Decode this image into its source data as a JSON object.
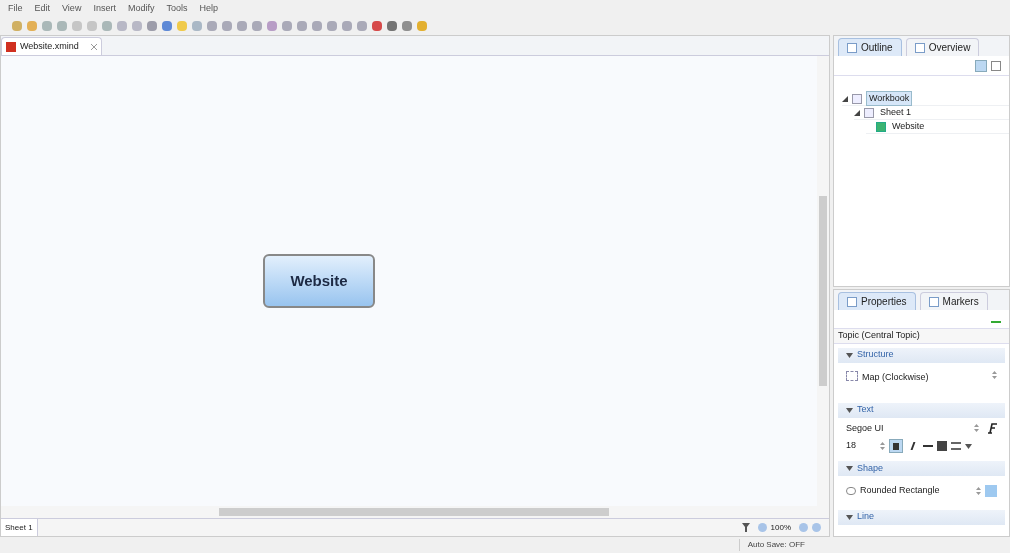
{
  "menu": [
    "File",
    "Edit",
    "View",
    "Insert",
    "Modify",
    "Tools",
    "Help"
  ],
  "editor": {
    "tab": "Website.xmind",
    "central_topic": "Website",
    "sheet_tab": "Sheet 1"
  },
  "zoom": {
    "value": "100%"
  },
  "outline": {
    "tabs": [
      {
        "label": "Outline",
        "selected": true
      },
      {
        "label": "Overview",
        "selected": false
      }
    ],
    "tree": [
      {
        "label": "Workbook",
        "selected": true,
        "expanded": true,
        "children": [
          {
            "label": "Sheet 1",
            "selected": false,
            "expanded": true,
            "children": [
              {
                "label": "Website",
                "selected": false
              }
            ]
          }
        ]
      }
    ]
  },
  "properties": {
    "tabs": [
      {
        "label": "Properties",
        "selected": true
      },
      {
        "label": "Markers",
        "selected": false
      }
    ],
    "title": "Topic (Central Topic)",
    "sections": [
      {
        "kind": "structure",
        "title": "Structure",
        "value": "Map (Clockwise)"
      },
      {
        "kind": "text",
        "title": "Text",
        "font": "Segoe UI",
        "size": "18",
        "bold": true,
        "italic": false
      },
      {
        "kind": "shape",
        "title": "Shape",
        "value": "Rounded Rectangle",
        "color": "#9ec9f0"
      },
      {
        "kind": "line",
        "title": "Line"
      }
    ]
  },
  "status_bar": {
    "auto_save": "Auto Save: OFF"
  }
}
